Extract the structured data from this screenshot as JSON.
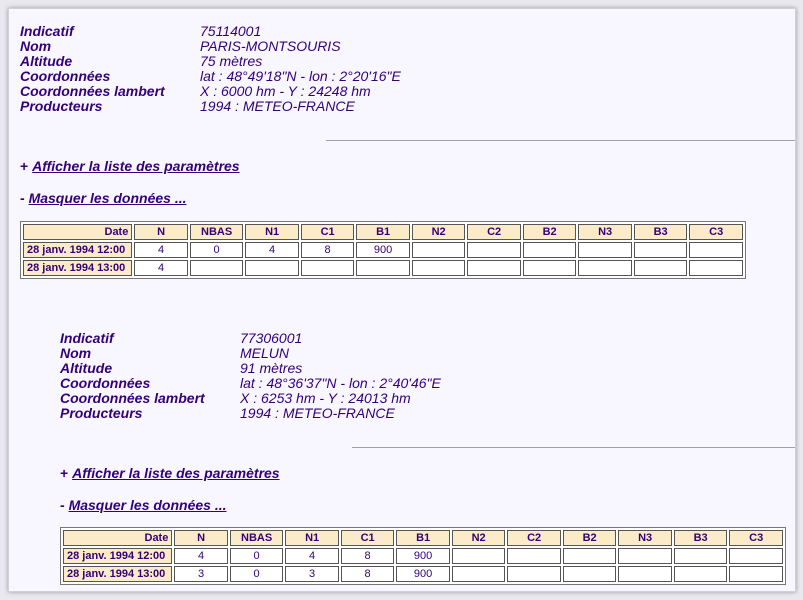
{
  "columns": [
    "Date",
    "N",
    "NBAS",
    "N1",
    "C1",
    "B1",
    "N2",
    "C2",
    "B2",
    "N3",
    "B3",
    "C3"
  ],
  "labels": {
    "indicatif": "Indicatif",
    "nom": "Nom",
    "altitude": "Altitude",
    "coord": "Coordonnées",
    "lambert": "Coordonnées lambert",
    "producteurs": "Producteurs"
  },
  "toggles": {
    "params_prefix": "+",
    "params_link": "Afficher la liste des paramètres",
    "data_prefix": "-",
    "data_link": "Masquer les données ..."
  },
  "stations": [
    {
      "indicatif": "75114001",
      "nom": "PARIS-MONTSOURIS",
      "altitude": "75 mètres",
      "coord": "lat : 48°49'18\"N - lon : 2°20'16\"E",
      "lambert": "X : 6000 hm - Y : 24248 hm",
      "producteurs": "1994 : METEO-FRANCE",
      "rows": [
        [
          "28 janv. 1994 12:00",
          "4",
          "0",
          "4",
          "8",
          "900",
          "",
          "",
          "",
          "",
          "",
          ""
        ],
        [
          "28 janv. 1994 13:00",
          "4",
          "",
          "",
          "",
          "",
          "",
          "",
          "",
          "",
          "",
          ""
        ]
      ]
    },
    {
      "indicatif": "77306001",
      "nom": "MELUN",
      "altitude": "91 mètres",
      "coord": "lat : 48°36'37\"N - lon : 2°40'46\"E",
      "lambert": "X : 6253 hm - Y : 24013 hm",
      "producteurs": "1994 : METEO-FRANCE",
      "rows": [
        [
          "28 janv. 1994 12:00",
          "4",
          "0",
          "4",
          "8",
          "900",
          "",
          "",
          "",
          "",
          "",
          ""
        ],
        [
          "28 janv. 1994 13:00",
          "3",
          "0",
          "3",
          "8",
          "900",
          "",
          "",
          "",
          "",
          "",
          ""
        ]
      ]
    }
  ]
}
